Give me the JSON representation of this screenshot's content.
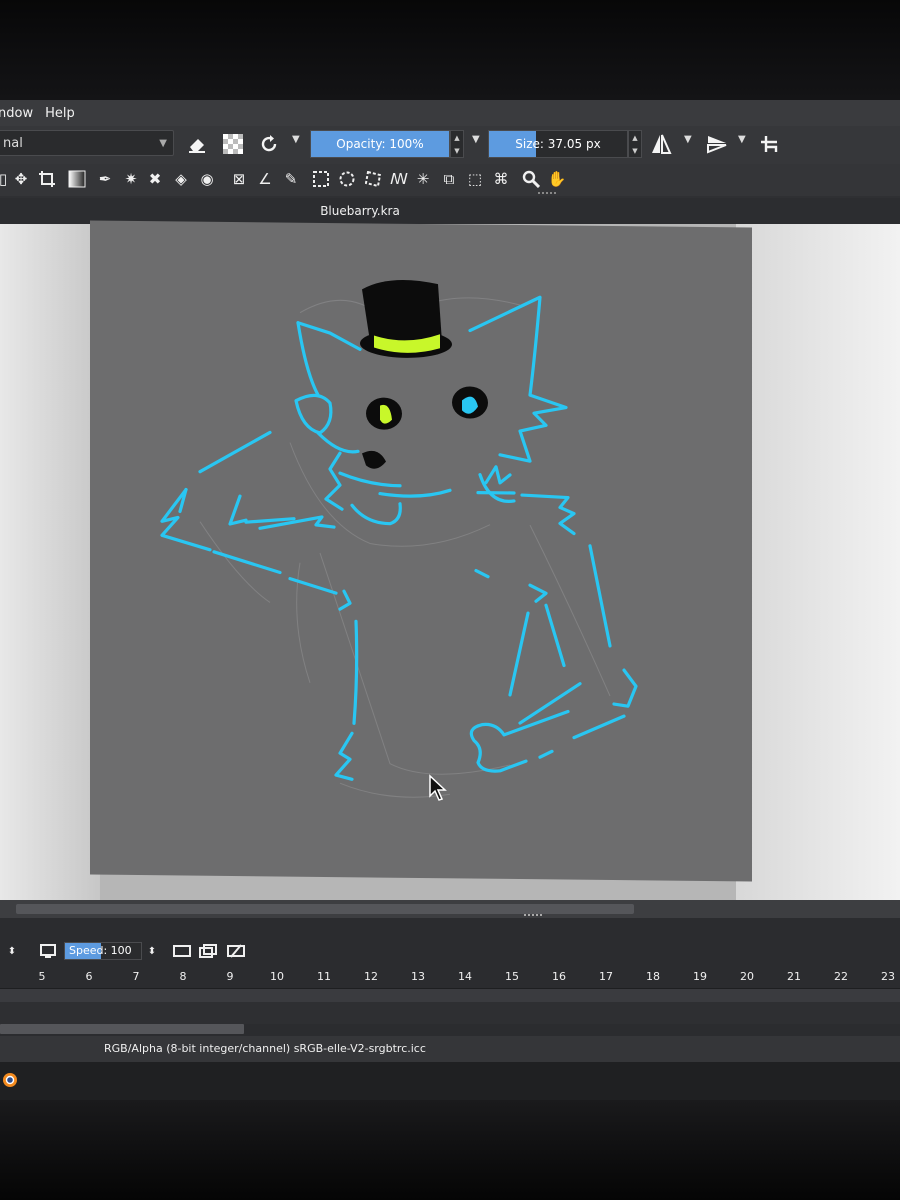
{
  "menubar": {
    "items": [
      "ndow",
      "Help"
    ]
  },
  "toolbar": {
    "blend_mode": "nal",
    "opacity_label": "Opacity: 100%",
    "opacity_value": 100,
    "size_label": "Size: 37.05 px"
  },
  "document": {
    "title": "Bluebarry.kra"
  },
  "animation": {
    "speed_label": "Speed: 100 %",
    "frames": [
      "5",
      "6",
      "7",
      "8",
      "9",
      "10",
      "11",
      "12",
      "13",
      "14",
      "15",
      "16",
      "17",
      "18",
      "19",
      "20",
      "21",
      "22",
      "23"
    ]
  },
  "status": {
    "color_info": "RGB/Alpha (8-bit integer/channel)  sRGB-elle-V2-srgbtrc.icc"
  },
  "icons": {
    "toolbar": [
      "eraser-icon",
      "alpha-lock-icon",
      "reload-preset-icon",
      "mirror-horizontal-icon",
      "mirror-vertical-icon",
      "wrap-around-icon"
    ],
    "tools": [
      "transform-icon",
      "move-icon",
      "crop-icon",
      "gradient-icon",
      "color-picker-icon",
      "smart-patch-icon",
      "assistant-icon",
      "fill-icon",
      "enclose-fill-icon",
      "measure-icon",
      "reference-icon",
      "angle-icon",
      "rect-select-icon",
      "ellipse-select-icon",
      "polygon-select-icon",
      "freehand-select-icon",
      "contiguous-select-icon",
      "similar-select-icon",
      "bezier-select-icon",
      "magnetic-select-icon",
      "zoom-icon",
      "pan-icon"
    ]
  },
  "colors": {
    "accent": "#5d9be0",
    "lineart": "#29c6f2",
    "hat_band": "#c8f72a",
    "eye_blue": "#29c6f2"
  }
}
